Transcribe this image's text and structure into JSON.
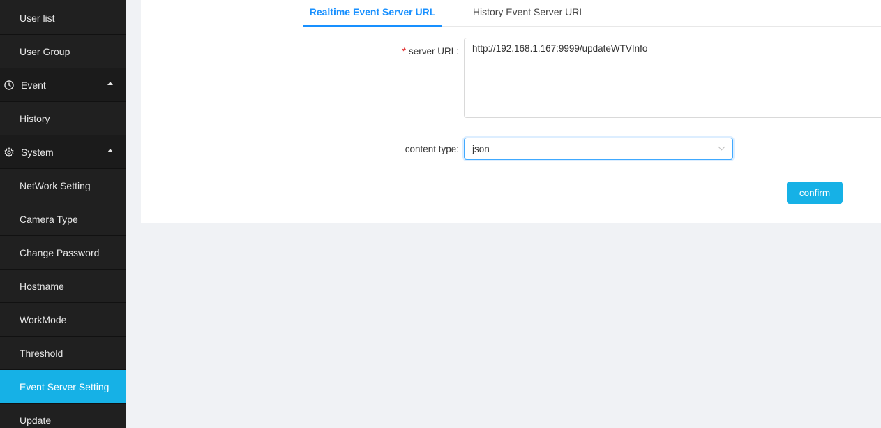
{
  "sidebar": {
    "items": [
      {
        "label": "User list"
      },
      {
        "label": "User Group"
      },
      {
        "label": "Event"
      },
      {
        "label": "History"
      },
      {
        "label": "System"
      },
      {
        "label": "NetWork Setting"
      },
      {
        "label": "Camera Type"
      },
      {
        "label": "Change Password"
      },
      {
        "label": "Hostname"
      },
      {
        "label": "WorkMode"
      },
      {
        "label": "Threshold"
      },
      {
        "label": "Event Server Setting"
      },
      {
        "label": "Update"
      }
    ],
    "active_item": "Event Server Setting"
  },
  "tabs": [
    {
      "label": "Realtime Event Server URL"
    },
    {
      "label": "History Event Server URL"
    }
  ],
  "form": {
    "server_url_label": "server URL:",
    "server_url_required_mark": "*",
    "server_url_value": "http://192.168.1.167:9999/updateWTVInfo",
    "content_type_label": "content type:",
    "content_type_value": "json",
    "confirm_label": "confirm"
  },
  "colors": {
    "accent": "#16b1e6",
    "tab_active": "#1890ff",
    "sidebar_bg": "#202020"
  },
  "icons": {
    "event": "clock-icon",
    "system": "gear-icon"
  }
}
